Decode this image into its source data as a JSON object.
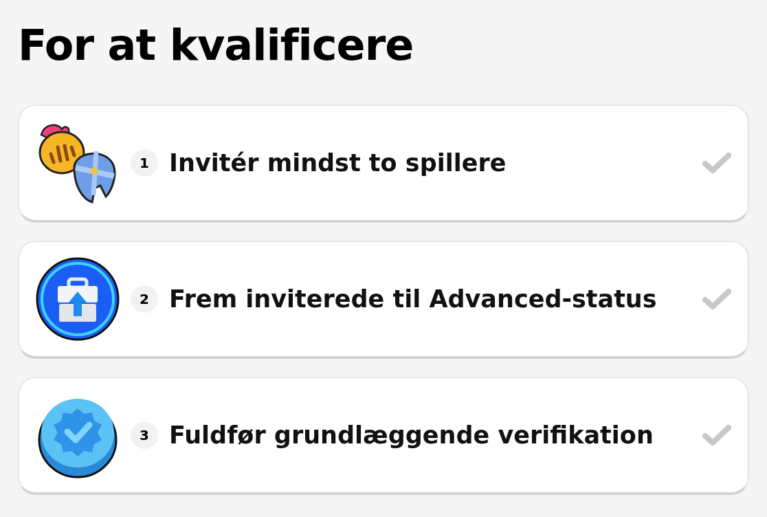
{
  "title": "For at kvalificere",
  "requirements": [
    {
      "kind": "helmets",
      "number": "1",
      "label": "Invitér mindst to spillere",
      "completed": false
    },
    {
      "kind": "briefcase",
      "number": "2",
      "label": "Frem inviterede til Advanced-status",
      "completed": false
    },
    {
      "kind": "badge",
      "number": "3",
      "label": "Fuldfør grundlæggende verifikation",
      "completed": false
    }
  ]
}
